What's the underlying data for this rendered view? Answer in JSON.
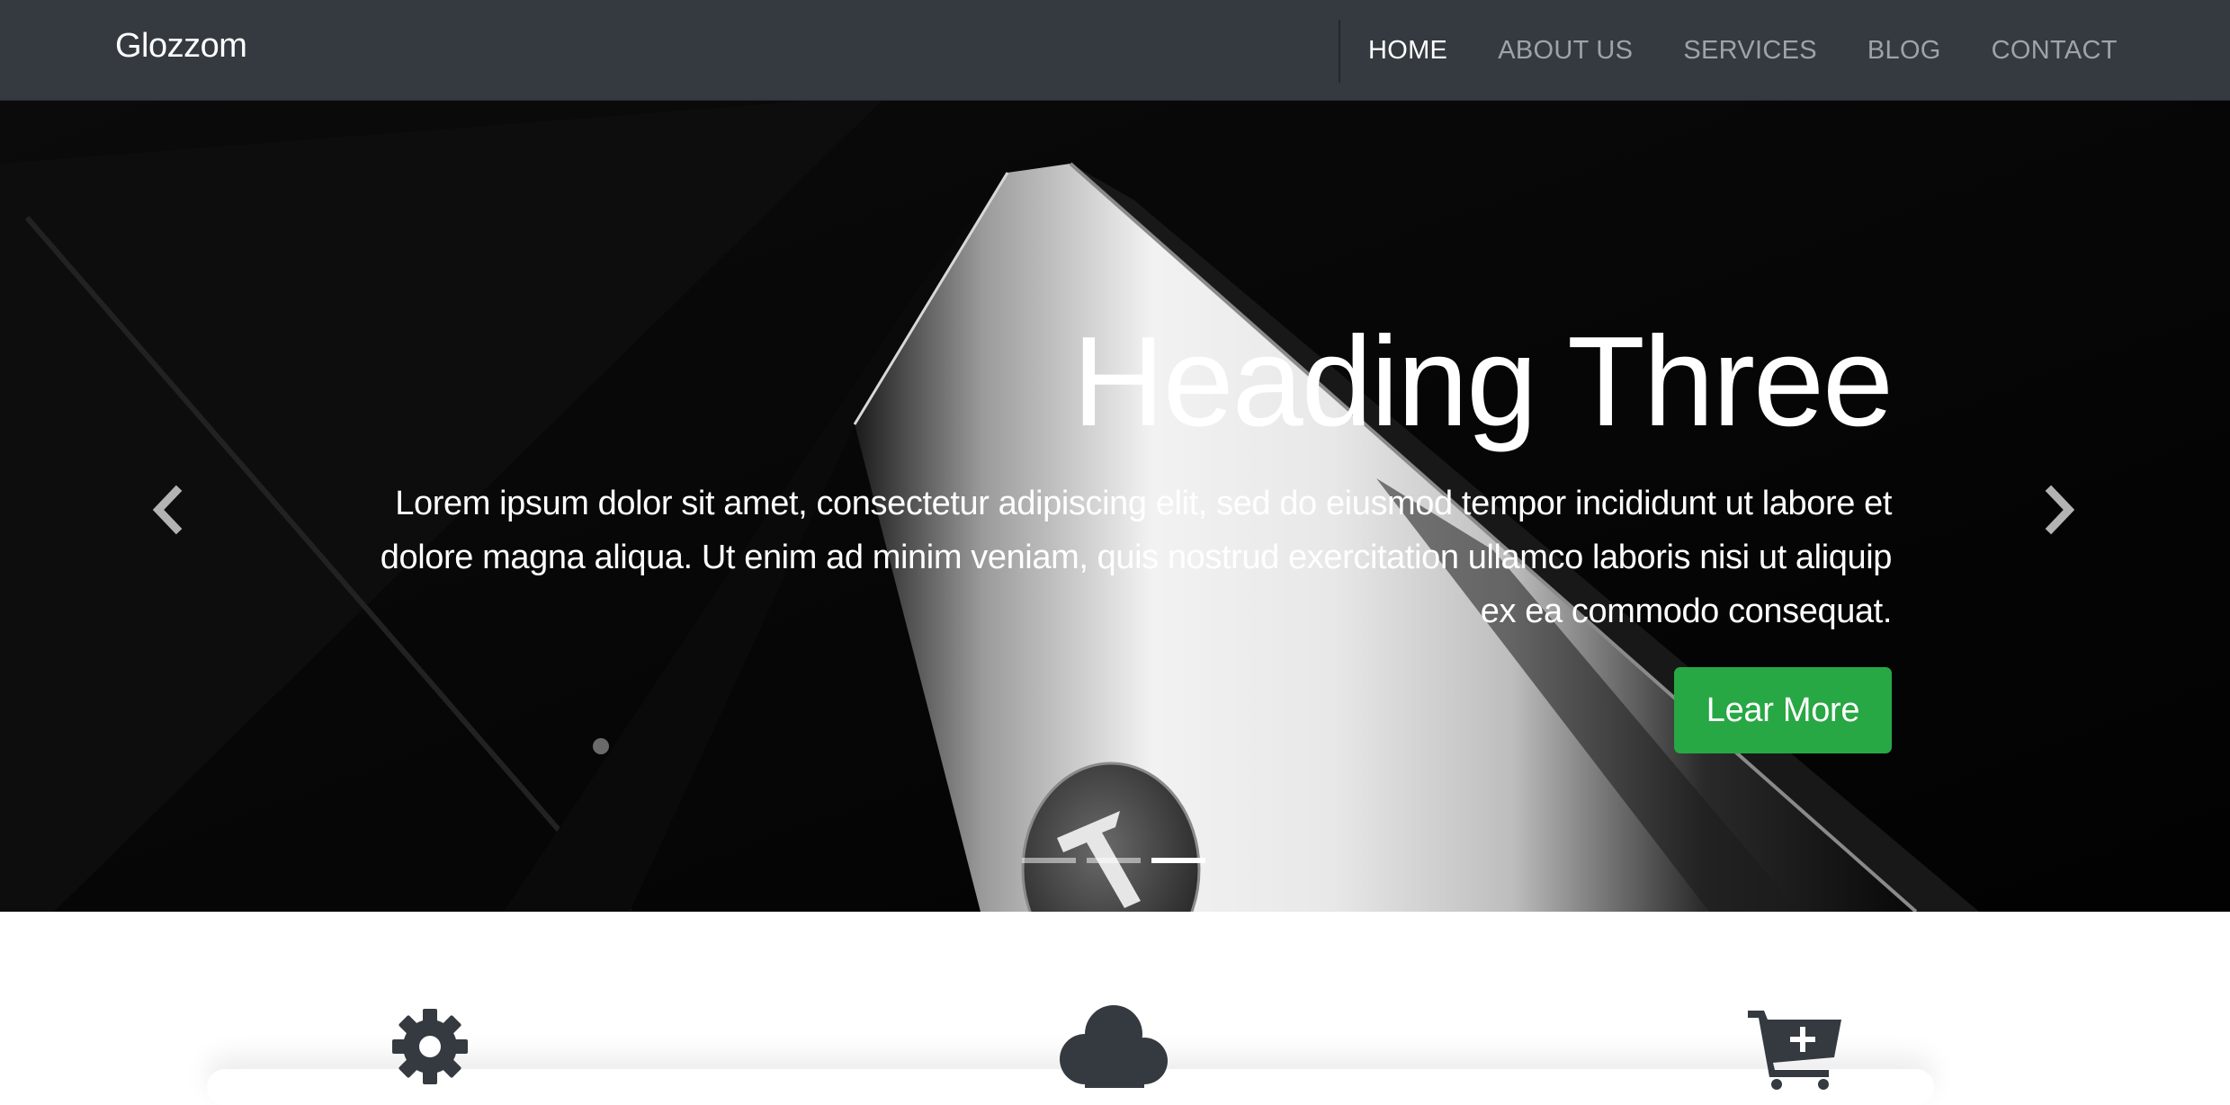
{
  "navbar": {
    "brand": "Glozzom",
    "links": [
      "HOME",
      "ABOUT US",
      "SERVICES",
      "BLOG",
      "CONTACT"
    ]
  },
  "hero": {
    "heading": "Heading Three",
    "text": "Lorem ipsum dolor sit amet, consectetur adipiscing elit, sed do eiusmod tempor incididunt ut labore et dolore magna aliqua. Ut enim ad minim veniam, quis nostrud exercitation ullamco laboris nisi ut aliquip ex ea commodo consequat.",
    "button_label": "Lear More",
    "indicators_total": 3,
    "active_indicator": 3
  },
  "features": {
    "icons": [
      "gear-icon",
      "cloud-icon",
      "cart-plus-icon"
    ]
  },
  "colors": {
    "navbar": "#343a40",
    "button": "#28a745",
    "icon": "#343a40"
  }
}
